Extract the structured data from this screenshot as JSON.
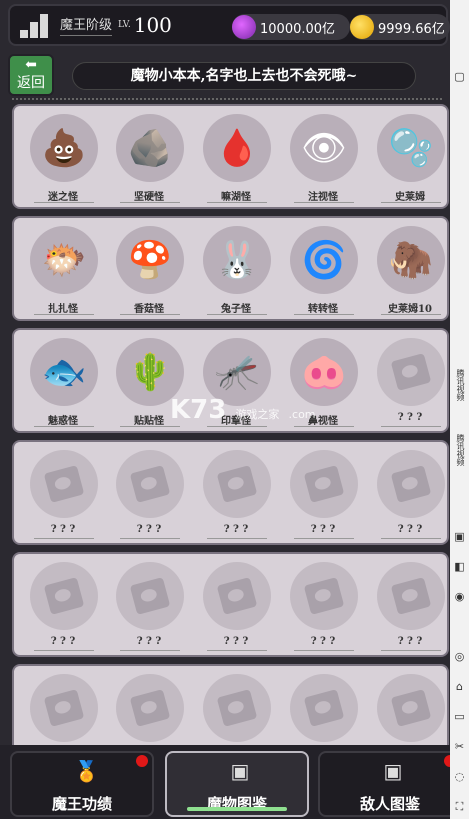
{
  "header": {
    "rank_label": "魔王阶级",
    "lv_prefix": "LV.",
    "level": "100",
    "crystal_amount": "10000.00亿",
    "gold_amount": "9999.66亿"
  },
  "nav": {
    "back_label": "返回",
    "banner_text": "魔物小本本,名字也上去也不会死哦~"
  },
  "monster_rows": [
    [
      {
        "name": "迷之怪",
        "icon": "poop-monster",
        "locked": false
      },
      {
        "name": "坚硬怪",
        "icon": "rock-monster",
        "locked": false
      },
      {
        "name": "嘛湖怪",
        "icon": "puddle-monster",
        "locked": false
      },
      {
        "name": "注视怪",
        "icon": "eyeball-monster",
        "locked": false
      },
      {
        "name": "史莱姆",
        "icon": "slime-monster",
        "locked": false
      }
    ],
    [
      {
        "name": "扎扎怪",
        "icon": "spiky-blob-monster",
        "locked": false
      },
      {
        "name": "香菇怪",
        "icon": "mushroom-lizard-monster",
        "locked": false
      },
      {
        "name": "兔子怪",
        "icon": "rabbit-mushroom-monster",
        "locked": false
      },
      {
        "name": "转转怪",
        "icon": "drill-monster",
        "locked": false
      },
      {
        "name": "史莱姆10",
        "icon": "mammoth-monster",
        "locked": false
      }
    ],
    [
      {
        "name": "魅惑怪",
        "icon": "bow-fish-monster",
        "locked": false
      },
      {
        "name": "贴贴怪",
        "icon": "cactus-monster",
        "locked": false
      },
      {
        "name": "印章怪",
        "icon": "mosquito-monster",
        "locked": false
      },
      {
        "name": "鼻视怪",
        "icon": "pig-nose-monster",
        "locked": false
      },
      {
        "name": "? ? ?",
        "icon": "locked-camera",
        "locked": true
      }
    ],
    [
      {
        "name": "? ? ?",
        "icon": "locked-camera",
        "locked": true
      },
      {
        "name": "? ? ?",
        "icon": "locked-camera",
        "locked": true
      },
      {
        "name": "? ? ?",
        "icon": "locked-camera",
        "locked": true
      },
      {
        "name": "? ? ?",
        "icon": "locked-camera",
        "locked": true
      },
      {
        "name": "? ? ?",
        "icon": "locked-camera",
        "locked": true
      }
    ],
    [
      {
        "name": "? ? ?",
        "icon": "locked-camera",
        "locked": true
      },
      {
        "name": "? ? ?",
        "icon": "locked-camera",
        "locked": true
      },
      {
        "name": "? ? ?",
        "icon": "locked-camera",
        "locked": true
      },
      {
        "name": "? ? ?",
        "icon": "locked-camera",
        "locked": true
      },
      {
        "name": "? ? ?",
        "icon": "locked-camera",
        "locked": true
      }
    ],
    [
      {
        "name": "",
        "icon": "locked-camera",
        "locked": true
      },
      {
        "name": "",
        "icon": "locked-camera",
        "locked": true
      },
      {
        "name": "",
        "icon": "locked-camera",
        "locked": true
      },
      {
        "name": "",
        "icon": "locked-camera",
        "locked": true
      },
      {
        "name": "",
        "icon": "locked-camera",
        "locked": true
      }
    ]
  ],
  "tabs": [
    {
      "label": "魔王功绩",
      "icon": "medal-icon",
      "active": false,
      "badge": true
    },
    {
      "label": "魔物图鉴",
      "icon": "monster-book-icon",
      "active": true,
      "badge": false
    },
    {
      "label": "敌人图鉴",
      "icon": "enemy-book-icon",
      "active": false,
      "badge": true
    }
  ],
  "watermark": {
    "brand": "K73",
    "site": "游戏之家",
    "domain": ".com"
  },
  "sidebar_texts": [
    "腾讯视频",
    "腾讯视频"
  ],
  "colors": {
    "back_button": "#3f8f4a",
    "badge": "#e01818",
    "active_underline": "#8fe090",
    "card_bg": "#d8d1d8"
  }
}
